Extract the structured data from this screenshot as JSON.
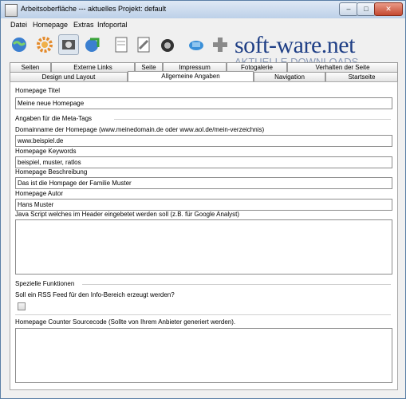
{
  "window": {
    "title": "Arbeitsoberfläche --- aktuelles Projekt: default",
    "minimize": "–",
    "maximize": "□",
    "close": "✕"
  },
  "menu": [
    "Datei",
    "Homepage",
    "Extras",
    "Infoportal"
  ],
  "toolbar": {
    "icons": [
      "globe-icon",
      "gear-icon",
      "film-gear-icon",
      "globe-arrow-icon",
      "document-icon",
      "settings-document-icon",
      "camera-icon",
      "monitor-icon",
      "plus-icon"
    ],
    "active_index": 2
  },
  "watermark": {
    "brand": "soft-ware.net",
    "subtitle": "AKTUELLE DOWNLOADS"
  },
  "tabs": {
    "row1": [
      "Seiten",
      "Externe Links",
      "Seite",
      "Impressum",
      "Fotogalerie",
      "Verhalten der Seite"
    ],
    "row2": [
      "Design und Layout",
      "Allgemeine Angaben",
      "Navigation",
      "Startseite"
    ],
    "active": "Allgemeine Angaben"
  },
  "form": {
    "title_label": "Homepage Titel",
    "title_value": "Meine neue Homepage",
    "meta_group": "Angaben für die Meta-Tags",
    "domain_label": "Domainname der Homepage (www.meinedomain.de oder www.aol.de/mein-verzeichnis)",
    "domain_value": "www.beispiel.de",
    "keywords_label": "Homepage Keywords",
    "keywords_value": "beispiel, muster, ratlos",
    "description_label": "Homepage Beschreibung",
    "description_value": "Das ist die Hompage der Familie Muster",
    "author_label": "Homepage Autor",
    "author_value": "Hans Muster",
    "javascript_label": "Java Script welches im Header eingebetet werden soll (z.B. für Google Analyst)",
    "special_group": "Spezielle Funktionen",
    "rss_label": "Soll ein RSS Feed für den Info-Bereich erzeugt werden?",
    "rss_checked": false,
    "counter_label": "Homepage Counter Sourcecode (Sollte von Ihrem Anbieter generiert werden)."
  }
}
